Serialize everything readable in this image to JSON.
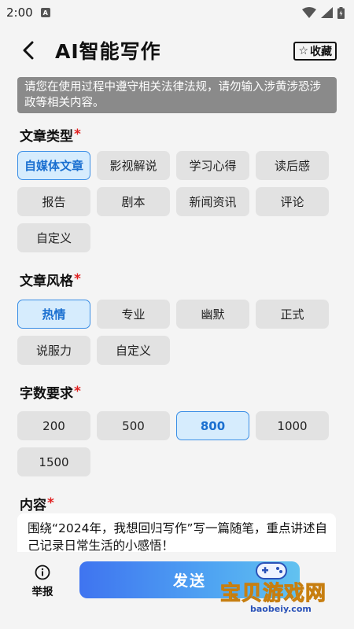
{
  "status_bar": {
    "time": "2:00",
    "notif_icon_letter": "A"
  },
  "header": {
    "title": "AI智能写作",
    "fav_label": "收藏",
    "fav_star": "☆"
  },
  "notice": "请您在使用过程中遵守相关法律法规，请勿输入涉黄涉恐涉政等相关内容。",
  "sections": {
    "type": {
      "label": "文章类型",
      "required": "*",
      "options": [
        "自媒体文章",
        "影视解说",
        "学习心得",
        "读后感",
        "报告",
        "剧本",
        "新闻资讯",
        "评论",
        "自定义"
      ],
      "selected": "自媒体文章"
    },
    "style": {
      "label": "文章风格",
      "required": "*",
      "options": [
        "热情",
        "专业",
        "幽默",
        "正式",
        "说服力",
        "自定义"
      ],
      "selected": "热情"
    },
    "length": {
      "label": "字数要求",
      "required": "*",
      "options": [
        "200",
        "500",
        "800",
        "1000",
        "1500"
      ],
      "selected": "800"
    },
    "content": {
      "label": "内容",
      "required": "*",
      "value": "围绕“2024年，我想回归写作”写一篇随笔，重点讲述自己记录日常生活的小感悟！"
    }
  },
  "bottom": {
    "report_label": "举报",
    "send_label": "发送"
  },
  "watermark": {
    "text": "宝贝游戏网",
    "url": "baobeiy.com"
  },
  "colors": {
    "selected_bg": "#d6ecfd",
    "selected_border": "#3a8ee6",
    "chip_bg": "#e2e2e2",
    "required": "#e02020",
    "send_gradient_start": "#3f74f0",
    "send_gradient_end": "#62c2f0"
  }
}
